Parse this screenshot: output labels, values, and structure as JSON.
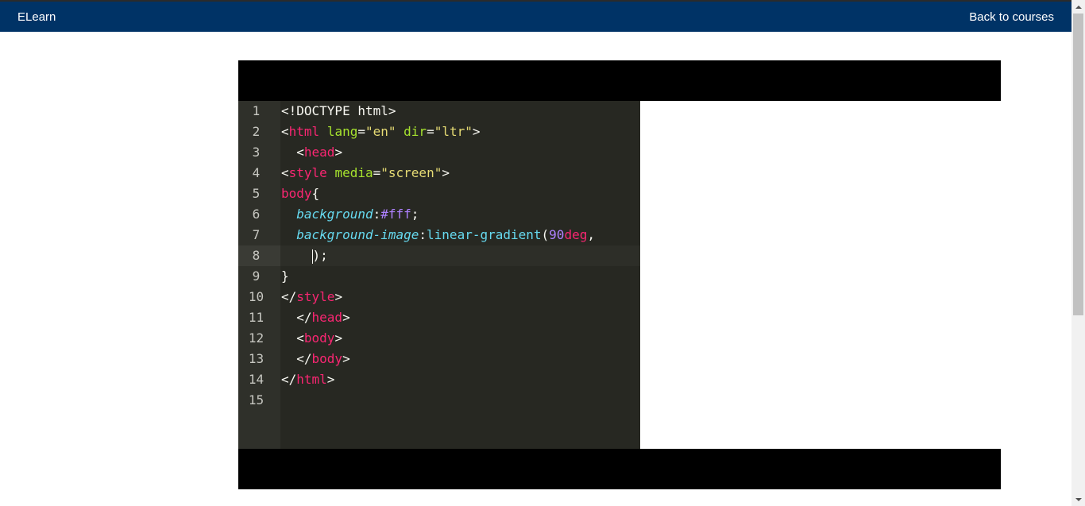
{
  "navbar": {
    "brand": "ELearn",
    "back_link": "Back to courses",
    "background": "#003366"
  },
  "video": {
    "editor_theme": "monokai",
    "lines": [
      {
        "n": "1",
        "tokens": [
          {
            "t": "<!DOCTYPE html>",
            "c": "plain"
          }
        ]
      },
      {
        "n": "2",
        "tokens": [
          {
            "t": "<",
            "c": "plain"
          },
          {
            "t": "html",
            "c": "tag"
          },
          {
            "t": " ",
            "c": "plain"
          },
          {
            "t": "lang",
            "c": "attr"
          },
          {
            "t": "=",
            "c": "plain"
          },
          {
            "t": "\"en\"",
            "c": "str"
          },
          {
            "t": " ",
            "c": "plain"
          },
          {
            "t": "dir",
            "c": "attr"
          },
          {
            "t": "=",
            "c": "plain"
          },
          {
            "t": "\"ltr\"",
            "c": "str"
          },
          {
            "t": ">",
            "c": "plain"
          }
        ]
      },
      {
        "n": "3",
        "tokens": [
          {
            "t": "  <",
            "c": "plain"
          },
          {
            "t": "head",
            "c": "tag"
          },
          {
            "t": ">",
            "c": "plain"
          }
        ]
      },
      {
        "n": "4",
        "tokens": [
          {
            "t": "<",
            "c": "plain"
          },
          {
            "t": "style",
            "c": "tag"
          },
          {
            "t": " ",
            "c": "plain"
          },
          {
            "t": "media",
            "c": "attr"
          },
          {
            "t": "=",
            "c": "plain"
          },
          {
            "t": "\"screen\"",
            "c": "str"
          },
          {
            "t": ">",
            "c": "plain"
          }
        ]
      },
      {
        "n": "5",
        "tokens": [
          {
            "t": "body",
            "c": "tag"
          },
          {
            "t": "{",
            "c": "plain"
          }
        ]
      },
      {
        "n": "6",
        "tokens": [
          {
            "t": "  ",
            "c": "plain"
          },
          {
            "t": "background",
            "c": "prop"
          },
          {
            "t": ":",
            "c": "plain"
          },
          {
            "t": "#fff",
            "c": "num"
          },
          {
            "t": ";",
            "c": "plain"
          }
        ]
      },
      {
        "n": "7",
        "tokens": [
          {
            "t": "  ",
            "c": "plain"
          },
          {
            "t": "background-image",
            "c": "prop"
          },
          {
            "t": ":",
            "c": "plain"
          },
          {
            "t": "linear-gradient",
            "c": "fn"
          },
          {
            "t": "(",
            "c": "plain"
          },
          {
            "t": "90",
            "c": "num"
          },
          {
            "t": "deg",
            "c": "unit"
          },
          {
            "t": ",",
            "c": "plain"
          }
        ]
      },
      {
        "n": "8",
        "active": true,
        "tokens": [
          {
            "t": "    ",
            "c": "plain"
          },
          {
            "t": "|",
            "c": "cursor"
          },
          {
            "t": ");",
            "c": "plain"
          }
        ]
      },
      {
        "n": "9",
        "tokens": [
          {
            "t": "}",
            "c": "plain"
          }
        ]
      },
      {
        "n": "10",
        "tokens": [
          {
            "t": "</",
            "c": "plain"
          },
          {
            "t": "style",
            "c": "tag"
          },
          {
            "t": ">",
            "c": "plain"
          }
        ]
      },
      {
        "n": "11",
        "tokens": [
          {
            "t": "  </",
            "c": "plain"
          },
          {
            "t": "head",
            "c": "tag"
          },
          {
            "t": ">",
            "c": "plain"
          }
        ]
      },
      {
        "n": "12",
        "tokens": [
          {
            "t": "  <",
            "c": "plain"
          },
          {
            "t": "body",
            "c": "tag"
          },
          {
            "t": ">",
            "c": "plain"
          }
        ]
      },
      {
        "n": "13",
        "tokens": [
          {
            "t": "  </",
            "c": "plain"
          },
          {
            "t": "body",
            "c": "tag"
          },
          {
            "t": ">",
            "c": "plain"
          }
        ]
      },
      {
        "n": "14",
        "tokens": [
          {
            "t": "</",
            "c": "plain"
          },
          {
            "t": "html",
            "c": "tag"
          },
          {
            "t": ">",
            "c": "plain"
          }
        ]
      },
      {
        "n": "15",
        "tokens": []
      }
    ]
  }
}
